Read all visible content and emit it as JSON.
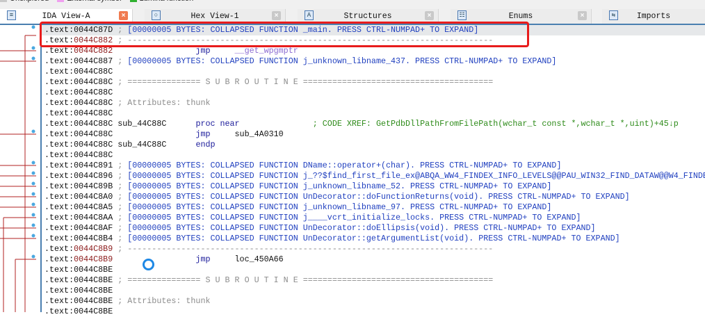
{
  "legend": [
    {
      "label": "Unexplored",
      "color": "#c8c8c8"
    },
    {
      "label": "External symbol",
      "color": "#f0a0f0"
    },
    {
      "label": "Lumina function",
      "color": "#30b030"
    }
  ],
  "tabs": [
    {
      "label": "IDA View-A",
      "icon": "graph-view-icon",
      "active": true,
      "closable": true
    },
    {
      "label": "Hex View-1",
      "icon": "hex-view-icon",
      "active": false,
      "closable": true
    },
    {
      "label": "Structures",
      "icon": "structures-icon",
      "active": false,
      "closable": true
    },
    {
      "label": "Enums",
      "icon": "enums-icon",
      "active": false,
      "closable": true
    },
    {
      "label": "Imports",
      "icon": "imports-icon",
      "active": false,
      "closable": false
    }
  ],
  "close_glyph": "×",
  "lines": [
    {
      "prefix": ".text:",
      "addr": "0044C87D",
      "sel": true,
      "parts": [
        {
          "t": " ; ",
          "c": "c-gray"
        },
        {
          "t": "[00000005 BYTES: COLLAPSED FUNCTION _main. PRESS CTRL-NUMPAD+ TO EXPAND]",
          "c": "c-blue"
        }
      ]
    },
    {
      "prefix": ".text:",
      "addr": "0044C882",
      "red": true,
      "parts": [
        {
          "t": " ; ---------------------------------------------------------------------------",
          "c": "c-gray"
        }
      ]
    },
    {
      "prefix": ".text:",
      "addr": "0044C882",
      "red": true,
      "parts": [
        {
          "t": "                 jmp     ",
          "c": "c-navy"
        },
        {
          "t": "__get_wpgmptr",
          "c": "c-purple"
        }
      ]
    },
    {
      "prefix": ".text:",
      "addr": "0044C887",
      "parts": [
        {
          "t": " ; ",
          "c": "c-gray"
        },
        {
          "t": "[00000005 BYTES: COLLAPSED FUNCTION j_unknown_libname_437. PRESS CTRL-NUMPAD+ TO EXPAND]",
          "c": "c-blue"
        }
      ]
    },
    {
      "prefix": ".text:",
      "addr": "0044C88C",
      "parts": []
    },
    {
      "prefix": ".text:",
      "addr": "0044C88C",
      "parts": [
        {
          "t": " ; =============== S U B R O U T I N E =======================================",
          "c": "c-gray"
        }
      ]
    },
    {
      "prefix": ".text:",
      "addr": "0044C88C",
      "parts": []
    },
    {
      "prefix": ".text:",
      "addr": "0044C88C",
      "parts": [
        {
          "t": " ; Attributes: thunk",
          "c": "c-gray"
        }
      ]
    },
    {
      "prefix": ".text:",
      "addr": "0044C88C",
      "parts": []
    },
    {
      "prefix": ".text:",
      "addr": "0044C88C",
      "parts": [
        {
          "t": " sub_44C88C      ",
          "c": "c-black"
        },
        {
          "t": "proc near",
          "c": "c-navy"
        },
        {
          "t": "               ; CODE XREF: GetPdbDllPathFromFilePath(wchar_t const *,wchar_t *,uint)+45↓p",
          "c": "c-green"
        }
      ]
    },
    {
      "prefix": ".text:",
      "addr": "0044C88C",
      "parts": [
        {
          "t": "                 jmp     ",
          "c": "c-navy"
        },
        {
          "t": "sub_4A0310",
          "c": "c-black"
        }
      ]
    },
    {
      "prefix": ".text:",
      "addr": "0044C88C",
      "parts": [
        {
          "t": " sub_44C88C      ",
          "c": "c-black"
        },
        {
          "t": "endp",
          "c": "c-navy"
        }
      ]
    },
    {
      "prefix": ".text:",
      "addr": "0044C88C",
      "parts": []
    },
    {
      "prefix": ".text:",
      "addr": "0044C891",
      "parts": [
        {
          "t": " ; ",
          "c": "c-gray"
        },
        {
          "t": "[00000005 BYTES: COLLAPSED FUNCTION DName::operator+(char). PRESS CTRL-NUMPAD+ TO EXPAND]",
          "c": "c-blue"
        }
      ]
    },
    {
      "prefix": ".text:",
      "addr": "0044C896",
      "parts": [
        {
          "t": " ; ",
          "c": "c-gray"
        },
        {
          "t": "[00000005 BYTES: COLLAPSED FUNCTION j_??$find_first_file_ex@ABQA_WW4_FINDEX_INFO_LEVELS@@PAU_WIN32_FIND_DATAW@@W4_FINDE",
          "c": "c-blue"
        }
      ]
    },
    {
      "prefix": ".text:",
      "addr": "0044C89B",
      "parts": [
        {
          "t": " ; ",
          "c": "c-gray"
        },
        {
          "t": "[00000005 BYTES: COLLAPSED FUNCTION j_unknown_libname_52. PRESS CTRL-NUMPAD+ TO EXPAND]",
          "c": "c-blue"
        }
      ]
    },
    {
      "prefix": ".text:",
      "addr": "0044C8A0",
      "parts": [
        {
          "t": " ; ",
          "c": "c-gray"
        },
        {
          "t": "[00000005 BYTES: COLLAPSED FUNCTION UnDecorator::doFunctionReturns(void). PRESS CTRL-NUMPAD+ TO EXPAND]",
          "c": "c-blue"
        }
      ]
    },
    {
      "prefix": ".text:",
      "addr": "0044C8A5",
      "parts": [
        {
          "t": " ; ",
          "c": "c-gray"
        },
        {
          "t": "[00000005 BYTES: COLLAPSED FUNCTION j_unknown_libname_97. PRESS CTRL-NUMPAD+ TO EXPAND]",
          "c": "c-blue"
        }
      ]
    },
    {
      "prefix": ".text:",
      "addr": "0044C8AA",
      "parts": [
        {
          "t": " ; ",
          "c": "c-gray"
        },
        {
          "t": "[00000005 BYTES: COLLAPSED FUNCTION j____vcrt_initialize_locks. PRESS CTRL-NUMPAD+ TO EXPAND]",
          "c": "c-blue"
        }
      ]
    },
    {
      "prefix": ".text:",
      "addr": "0044C8AF",
      "parts": [
        {
          "t": " ; ",
          "c": "c-gray"
        },
        {
          "t": "[00000005 BYTES: COLLAPSED FUNCTION UnDecorator::doEllipsis(void). PRESS CTRL-NUMPAD+ TO EXPAND]",
          "c": "c-blue"
        }
      ]
    },
    {
      "prefix": ".text:",
      "addr": "0044C8B4",
      "parts": [
        {
          "t": " ; ",
          "c": "c-gray"
        },
        {
          "t": "[00000005 BYTES: COLLAPSED FUNCTION UnDecorator::getArgumentList(void). PRESS CTRL-NUMPAD+ TO EXPAND]",
          "c": "c-blue"
        }
      ]
    },
    {
      "prefix": ".text:",
      "addr": "0044C8B9",
      "red": true,
      "parts": [
        {
          "t": " ; ---------------------------------------------------------------------------",
          "c": "c-gray"
        }
      ]
    },
    {
      "prefix": ".text:",
      "addr": "0044C8B9",
      "red": true,
      "parts": [
        {
          "t": "                 jmp     ",
          "c": "c-navy"
        },
        {
          "t": "loc_450A66",
          "c": "c-black"
        }
      ]
    },
    {
      "prefix": ".text:",
      "addr": "0044C8BE",
      "parts": []
    },
    {
      "prefix": ".text:",
      "addr": "0044C8BE",
      "parts": [
        {
          "t": " ; =============== S U B R O U T I N E =======================================",
          "c": "c-gray"
        }
      ]
    },
    {
      "prefix": ".text:",
      "addr": "0044C8BE",
      "parts": []
    },
    {
      "prefix": ".text:",
      "addr": "0044C8BE",
      "parts": [
        {
          "t": " ; Attributes: thunk",
          "c": "c-gray"
        }
      ]
    },
    {
      "prefix": ".text:",
      "addr": "0044C8BE",
      "parts": []
    }
  ]
}
